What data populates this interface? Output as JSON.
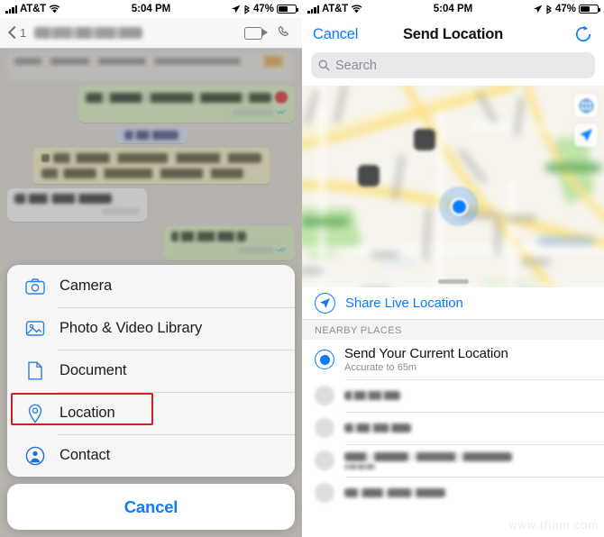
{
  "status_bar": {
    "carrier": "AT&T",
    "time": "5:04 PM",
    "battery_pct": "47%",
    "icons": [
      "signal-bars-icon",
      "wifi-icon",
      "location-arrow-icon",
      "bluetooth-icon",
      "battery-icon"
    ]
  },
  "left_screen": {
    "nav": {
      "back_badge": "1",
      "contact_name_redacted": "",
      "video_call_icon": "video-camera-icon",
      "voice_call_icon": "phone-handset-icon"
    },
    "chat": {
      "redacted": true,
      "messages": [
        {
          "kind": "ghost-header",
          "side": "top"
        },
        {
          "kind": "outgoing",
          "side": "out",
          "redacted": true,
          "has_emoji": true
        },
        {
          "kind": "date-pill",
          "side": "mid",
          "redacted": true
        },
        {
          "kind": "encryption-notice",
          "side": "mid",
          "redacted": true
        },
        {
          "kind": "incoming",
          "side": "in",
          "redacted": true
        },
        {
          "kind": "outgoing",
          "side": "out",
          "redacted": true
        },
        {
          "kind": "outgoing",
          "side": "out",
          "redacted": true
        }
      ]
    },
    "action_sheet": {
      "items": [
        {
          "label": "Camera",
          "icon": "camera-icon",
          "highlighted": false
        },
        {
          "label": "Photo & Video Library",
          "icon": "photo-library-icon",
          "highlighted": false
        },
        {
          "label": "Document",
          "icon": "document-icon",
          "highlighted": false
        },
        {
          "label": "Location",
          "icon": "location-pin-icon",
          "highlighted": true
        },
        {
          "label": "Contact",
          "icon": "contact-person-icon",
          "highlighted": false
        }
      ],
      "cancel_label": "Cancel",
      "highlight_color": "#cf1f24"
    }
  },
  "right_screen": {
    "nav": {
      "cancel_label": "Cancel",
      "title": "Send Location",
      "refresh_icon": "refresh-circle-icon"
    },
    "search": {
      "placeholder": "Search",
      "value": "",
      "icon": "search-icon"
    },
    "map": {
      "redacted": true,
      "user_dot": "blue-location-dot",
      "controls": [
        {
          "icon": "globe-3d-icon"
        },
        {
          "icon": "tracking-arrow-icon"
        }
      ],
      "poi_markers": 2,
      "drag_handle": "sheet-drag-handle"
    },
    "share_live": {
      "label": "Share Live Location",
      "icon": "live-location-icon"
    },
    "section_header": "NEARBY PLACES",
    "places": [
      {
        "title": "Send Your Current Location",
        "subtitle": "Accurate to 65m",
        "selected": true,
        "redacted": false
      },
      {
        "title": "",
        "subtitle": "",
        "selected": false,
        "redacted": true
      },
      {
        "title": "",
        "subtitle": "",
        "selected": false,
        "redacted": true
      },
      {
        "title": "",
        "subtitle": "",
        "selected": false,
        "redacted": true
      },
      {
        "title": "",
        "subtitle": "",
        "selected": false,
        "redacted": true
      }
    ]
  },
  "watermark": "www.tfiam.com",
  "colors": {
    "ios_blue": "#0a7cff",
    "highlight_red": "#cf1f24",
    "sheet_bg": "#f6f6f6",
    "chat_bg": "#e3ddd5",
    "outgoing_bubble": "#dcf7c5",
    "notice_bubble": "#fcf4cb"
  }
}
